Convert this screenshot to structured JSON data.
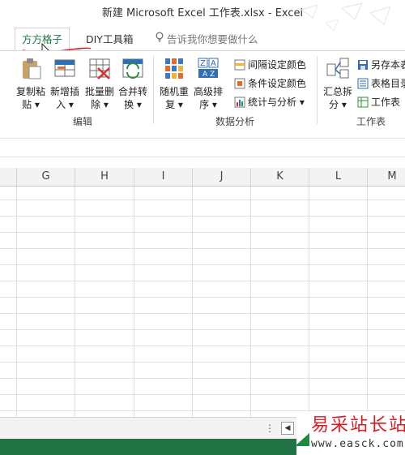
{
  "window": {
    "title": "新建 Microsoft Excel 工作表.xlsx - Excel"
  },
  "tabs": [
    {
      "label": "方方格子"
    },
    {
      "label": "DIY工具箱"
    }
  ],
  "tell_me": {
    "placeholder": "告诉我你想要做什么"
  },
  "ribbon": {
    "edit_group": {
      "label": "编辑",
      "buttons": [
        {
          "line1": "复制粘",
          "line2": "贴 ▾"
        },
        {
          "line1": "新增插",
          "line2": "入 ▾"
        },
        {
          "line1": "批量删",
          "line2": "除 ▾"
        },
        {
          "line1": "合并转",
          "line2": "换 ▾"
        }
      ]
    },
    "data_group": {
      "label": "数据分析",
      "buttons": [
        {
          "line1": "随机重",
          "line2": "复 ▾"
        },
        {
          "line1": "高级排",
          "line2": "序 ▾"
        }
      ],
      "small_buttons": [
        {
          "label": "间隔设定颜色"
        },
        {
          "label": "条件设定颜色"
        },
        {
          "label": "统计与分析 ▾"
        }
      ]
    },
    "sheet_group": {
      "label": "工作表",
      "buttons": [
        {
          "line1": "汇总拆",
          "line2": "分 ▾"
        }
      ],
      "small_buttons": [
        {
          "label": "另存本表"
        },
        {
          "label": "表格目录"
        },
        {
          "label": "工作表"
        }
      ]
    }
  },
  "columns": [
    "G",
    "H",
    "I",
    "J",
    "K",
    "L",
    "M"
  ],
  "sheet_nav": {
    "dots": "⋮",
    "prev": "◀"
  },
  "watermark": {
    "title": "易采站长站",
    "url": "www.easck.com"
  },
  "colors": {
    "excel_green": "#217346",
    "watermark_red": "#d81b24"
  }
}
